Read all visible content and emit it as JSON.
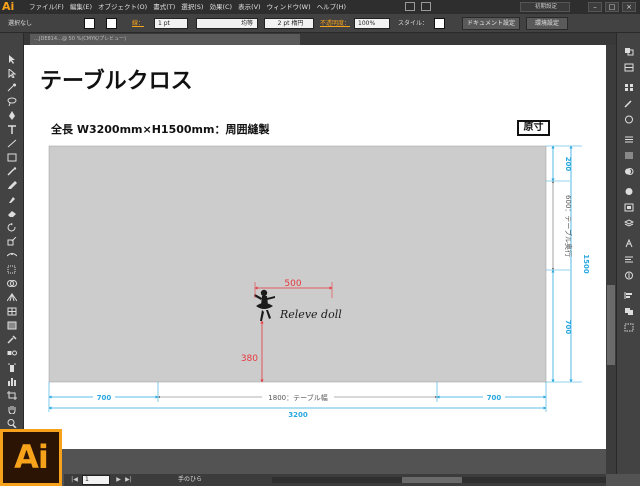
{
  "app": {
    "logo": "Ai",
    "menu": [
      "ファイル(F)",
      "編集(E)",
      "オブジェクト(O)",
      "書式(T)",
      "選択(S)",
      "効果(C)",
      "表示(V)",
      "ウィンドウ(W)",
      "ヘルプ(H)"
    ],
    "workspace": "初期設定",
    "window_buttons": [
      "–",
      "□",
      "×"
    ]
  },
  "control_bar": {
    "selection_state": "選択なし",
    "stroke_label": "線：",
    "stroke_weight": "1 pt",
    "stroke_profile": "均等",
    "brush": "2 pt 楕円",
    "opacity_label": "不透明度：",
    "opacity_value": "100%",
    "style_label": "スタイル：",
    "document_setup_button": "ドキュメント設定",
    "preferences_button": "環境設定"
  },
  "document": {
    "tab_title": "…JDE814…@ 50 %(CMYK/プレビュー)"
  },
  "status_bar": {
    "zoom": "50%",
    "page": "1",
    "current_tool": "手のひら"
  },
  "artwork": {
    "title": "テーブルクロス",
    "subtitle": "全長 W3200mm×H1500mm：周囲縫製",
    "badge": "原寸",
    "logo_text": "Releve doll",
    "dimensions": {
      "logo_width": "500",
      "logo_height": "380",
      "left_margin": "700",
      "right_margin": "700",
      "table_width": "1800：テーブル幅",
      "total_width": "3200",
      "top_margin": "200",
      "table_depth": "600：テーブル奥行",
      "bottom_margin": "700",
      "total_height": "1500"
    }
  },
  "colors": {
    "accent_orange": "#f7a21b",
    "cloth_gray": "#cccccc",
    "dim_blue": "#29a8e0",
    "dim_red": "#e8383d"
  }
}
